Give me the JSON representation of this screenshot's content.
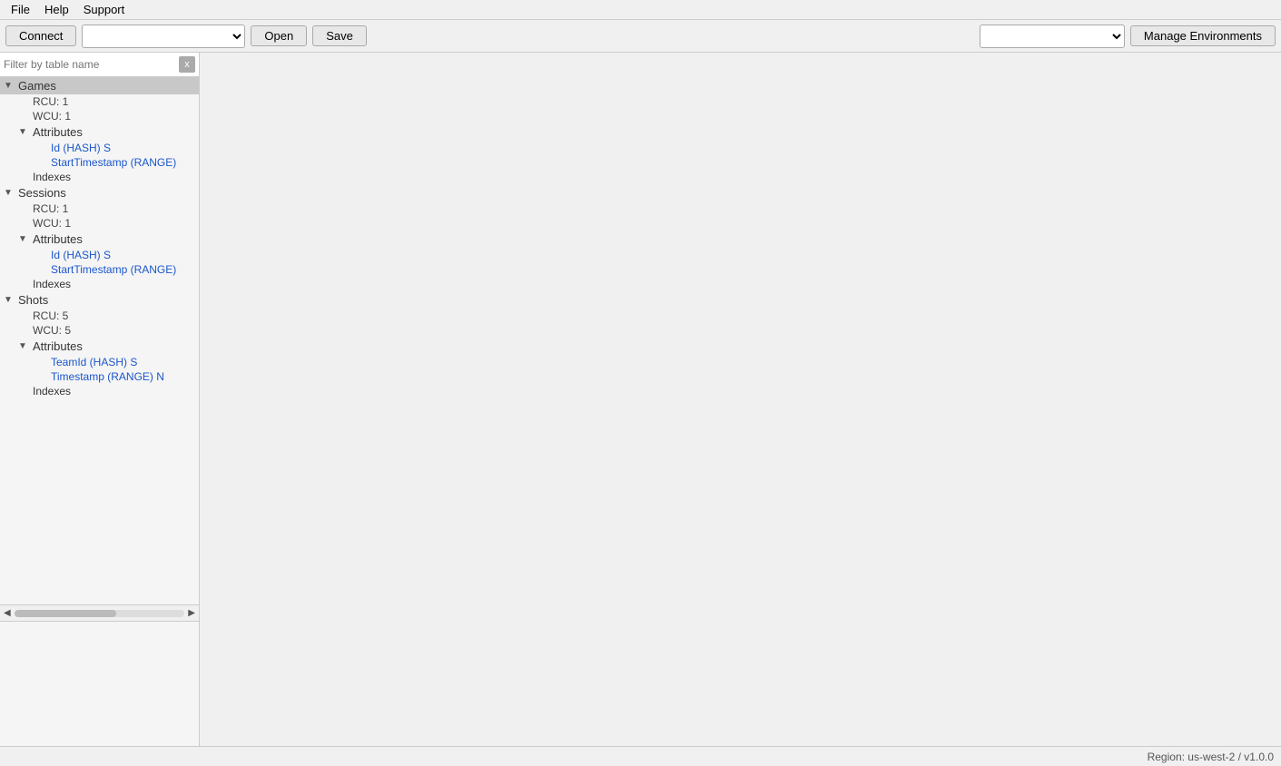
{
  "menu": {
    "file": "File",
    "help": "Help",
    "support": "Support"
  },
  "toolbar": {
    "connect_label": "Connect",
    "open_label": "Open",
    "save_label": "Save",
    "manage_env_label": "Manage Environments",
    "query_placeholder": "",
    "env_placeholder": ""
  },
  "sidebar": {
    "filter_placeholder": "Filter by table name",
    "filter_clear": "x",
    "tables": [
      {
        "name": "Games",
        "expanded": true,
        "selected": true,
        "rcu": "RCU: 1",
        "wcu": "WCU: 1",
        "attributes": {
          "label": "Attributes",
          "expanded": true,
          "items": [
            "Id (HASH) S",
            "StartTimestamp (RANGE)"
          ]
        },
        "indexes_label": "Indexes"
      },
      {
        "name": "Sessions",
        "expanded": true,
        "selected": false,
        "rcu": "RCU: 1",
        "wcu": "WCU: 1",
        "attributes": {
          "label": "Attributes",
          "expanded": true,
          "items": [
            "Id (HASH) S",
            "StartTimestamp (RANGE)"
          ]
        },
        "indexes_label": "Indexes"
      },
      {
        "name": "Shots",
        "expanded": true,
        "selected": false,
        "rcu": "RCU: 5",
        "wcu": "WCU: 5",
        "attributes": {
          "label": "Attributes",
          "expanded": true,
          "items": [
            "TeamId (HASH) S",
            "Timestamp (RANGE) N"
          ]
        },
        "indexes_label": "Indexes"
      }
    ]
  },
  "status": {
    "region": "Region: us-west-2 / v1.0.0"
  }
}
